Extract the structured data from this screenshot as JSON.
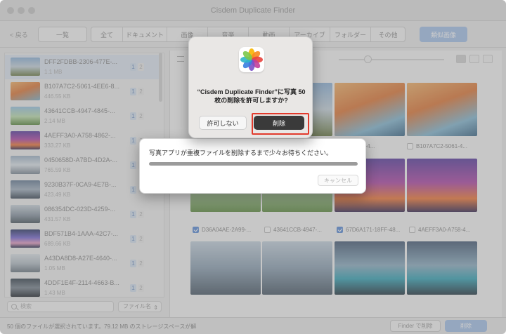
{
  "window": {
    "title": "Cisdem Duplicate Finder"
  },
  "toolbar": {
    "back_label": "< 戻る",
    "overview_label": "一覧",
    "categories": [
      "全て",
      "ドキュメント",
      "画像",
      "音楽",
      "動画",
      "アーカイブ",
      "フォルダー",
      "その他"
    ],
    "similar_label": "類似画像"
  },
  "files": [
    {
      "name": "DFF2FDBB-2306-477E-...",
      "size": "1.1 MB",
      "badges": [
        "1",
        "2"
      ]
    },
    {
      "name": "B107A7C2-5061-4EE6-8...",
      "size": "446.55 KB",
      "badges": [
        "1",
        "2"
      ]
    },
    {
      "name": "43641CCB-4947-4845-...",
      "size": "2.14 MB",
      "badges": [
        "1",
        "2"
      ]
    },
    {
      "name": "4AEFF3A0-A758-4862-...",
      "size": "333.27 KB",
      "badges": [
        "1",
        "2"
      ]
    },
    {
      "name": "0450658D-A7BD-4D2A-...",
      "size": "765.59 KB",
      "badges": [
        "1",
        "2"
      ]
    },
    {
      "name": "9230B37F-0CA9-4E7B-...",
      "size": "423.49 KB",
      "badges": [
        "1",
        "2"
      ]
    },
    {
      "name": "086354DC-023D-4259-...",
      "size": "431.57 KB",
      "badges": [
        "1",
        "2"
      ]
    },
    {
      "name": "BDF571B4-1AAA-42C7-...",
      "size": "689.66 KB",
      "badges": [
        "1",
        "2"
      ]
    },
    {
      "name": "A43DA8D8-A27E-4640-...",
      "size": "1.05 MB",
      "badges": [
        "1",
        "2"
      ]
    },
    {
      "name": "4DDF1E4F-2114-4663-B...",
      "size": "1.43 MB",
      "badges": [
        "1",
        "2"
      ]
    }
  ],
  "search": {
    "placeholder": "検索",
    "sort_label": "ファイル名"
  },
  "grid": {
    "row1": [
      "…7AA-9691-4...",
      "B107A7C2-5061-4..."
    ],
    "row2": [
      "D36A04AE-2A99-...",
      "43641CCB-4947-...",
      "67D6A171-18FF-48...",
      "4AEFF3A0-A758-4..."
    ],
    "row2_checked": [
      true,
      false,
      true,
      false
    ]
  },
  "status": {
    "text": "50 個のファイルが選択されています。79.12 MB のストレージスペースが解",
    "finder_label": "Finder で削除",
    "delete_label": "削除"
  },
  "alert": {
    "title": "“Cisdem Duplicate Finder”に写真 50 枚の削除を許可しますか?",
    "deny_label": "許可しない",
    "ok_label": "削除"
  },
  "progress": {
    "message": "写真アプリが重複ファイルを削除するまで少々お待ちください。",
    "percent": 100,
    "cancel_label": "キャンセル"
  },
  "colors": {
    "accent": "#a7c3ea",
    "alert_button": "#3a3a3a",
    "highlight": "#e23a2c"
  }
}
